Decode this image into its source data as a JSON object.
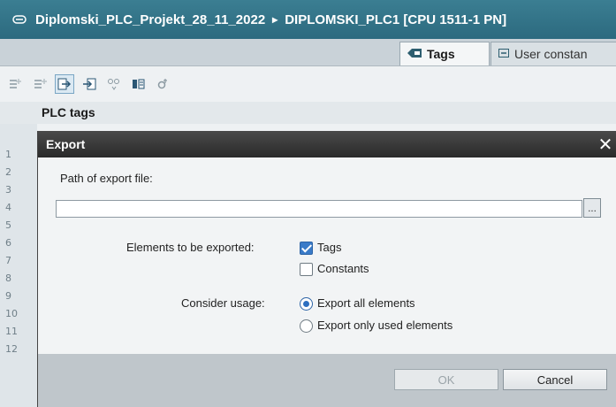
{
  "titlebar": {
    "project": "Diplomski_PLC_Projekt_28_11_2022",
    "separator": "▸",
    "device": "DIPLOMSKI_PLC1 [CPU 1511-1 PN]"
  },
  "tabs": [
    {
      "label": "Tags",
      "active": true
    },
    {
      "label": "User constan",
      "active": false
    }
  ],
  "plc_tags_title": "PLC tags",
  "row_numbers": [
    "1",
    "2",
    "3",
    "4",
    "5",
    "6",
    "7",
    "8",
    "9",
    "10",
    "11",
    "12"
  ],
  "dialog": {
    "title": "Export",
    "path_label": "Path of export file:",
    "path_value": "",
    "browse_label": "...",
    "elements_label": "Elements to be exported:",
    "elements": [
      {
        "label": "Tags",
        "checked": true
      },
      {
        "label": "Constants",
        "checked": false
      }
    ],
    "usage_label": "Consider usage:",
    "usage_options": [
      {
        "label": "Export all elements",
        "selected": true
      },
      {
        "label": "Export only used elements",
        "selected": false
      }
    ],
    "ok_label": "OK",
    "cancel_label": "Cancel"
  },
  "colors": {
    "titlebar": "#2f6f84",
    "dialog_title": "#333333",
    "checkbox_accent": "#3a7bc8"
  }
}
